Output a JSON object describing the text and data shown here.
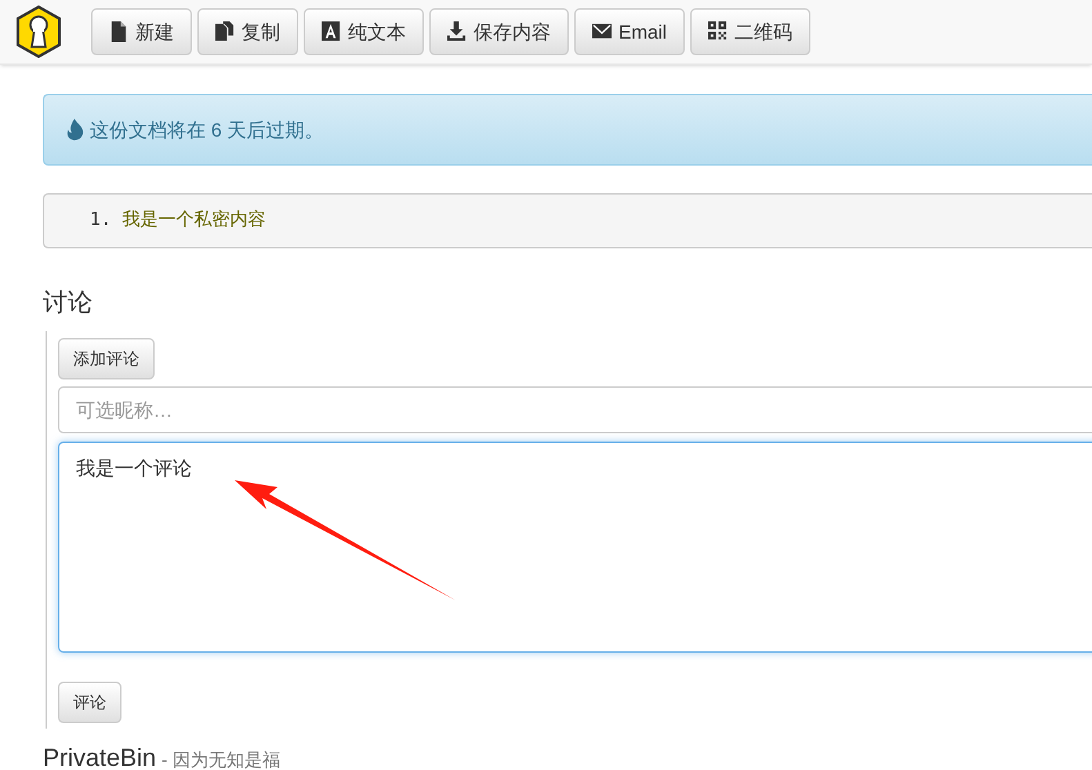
{
  "toolbar": {
    "buttons": [
      {
        "label": "新建"
      },
      {
        "label": "复制"
      },
      {
        "label": "纯文本"
      },
      {
        "label": "保存内容"
      },
      {
        "label": "Email"
      },
      {
        "label": "二维码"
      }
    ]
  },
  "alert": {
    "text": "这份文档将在 6 天后过期。"
  },
  "paste": {
    "lines": [
      {
        "number": "1.",
        "text": "我是一个私密内容"
      }
    ]
  },
  "discussion": {
    "heading": "讨论",
    "add_button": "添加评论",
    "nickname": {
      "placeholder": "可选昵称…"
    },
    "comment": {
      "value": "我是一个评论"
    },
    "submit_button": "评论"
  },
  "footer": {
    "brand": "PrivateBin",
    "tagline": "- 因为无知是福"
  }
}
